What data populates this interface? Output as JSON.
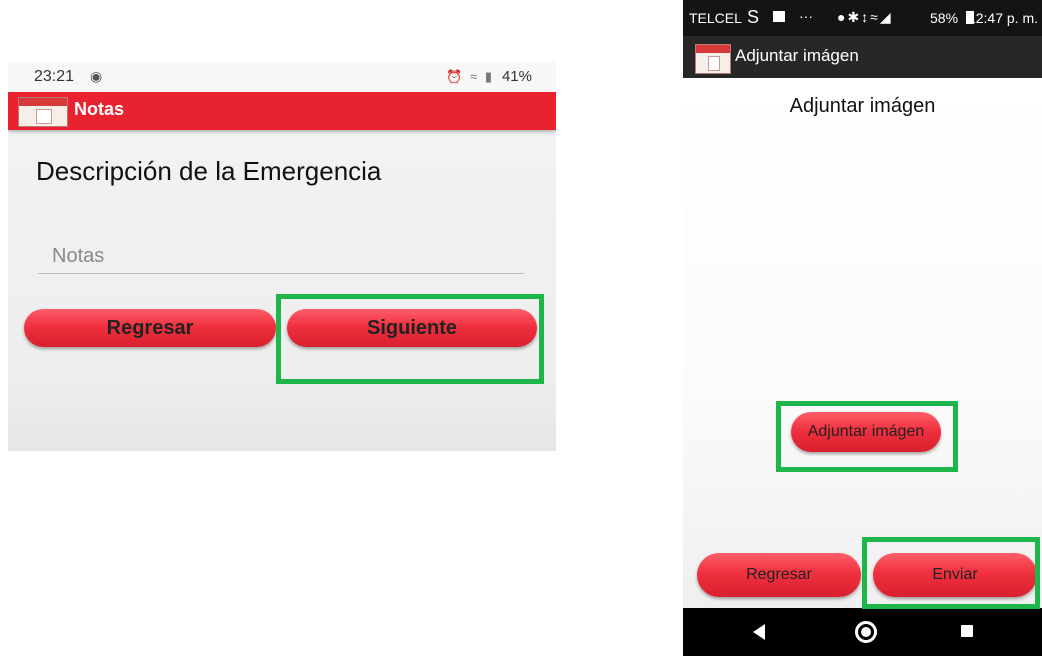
{
  "left_screen": {
    "status_bar": {
      "time": "23:21",
      "battery": "41%"
    },
    "app_bar": {
      "title": "Notas"
    },
    "heading": "Descripción de la Emergencia",
    "notes_field": {
      "placeholder": "Notas",
      "value": ""
    },
    "buttons": {
      "back": "Regresar",
      "next": "Siguiente"
    }
  },
  "right_screen": {
    "status_bar": {
      "carrier": "TELCEL",
      "battery": "58%",
      "time": "12:47 p. m."
    },
    "app_bar": {
      "title": "Adjuntar imágen"
    },
    "heading": "Adjuntar imágen",
    "buttons": {
      "attach": "Adjuntar imágen",
      "back": "Regresar",
      "send": "Enviar"
    }
  },
  "highlight_color": "#1eb64a",
  "accent_color": "#e8222f"
}
